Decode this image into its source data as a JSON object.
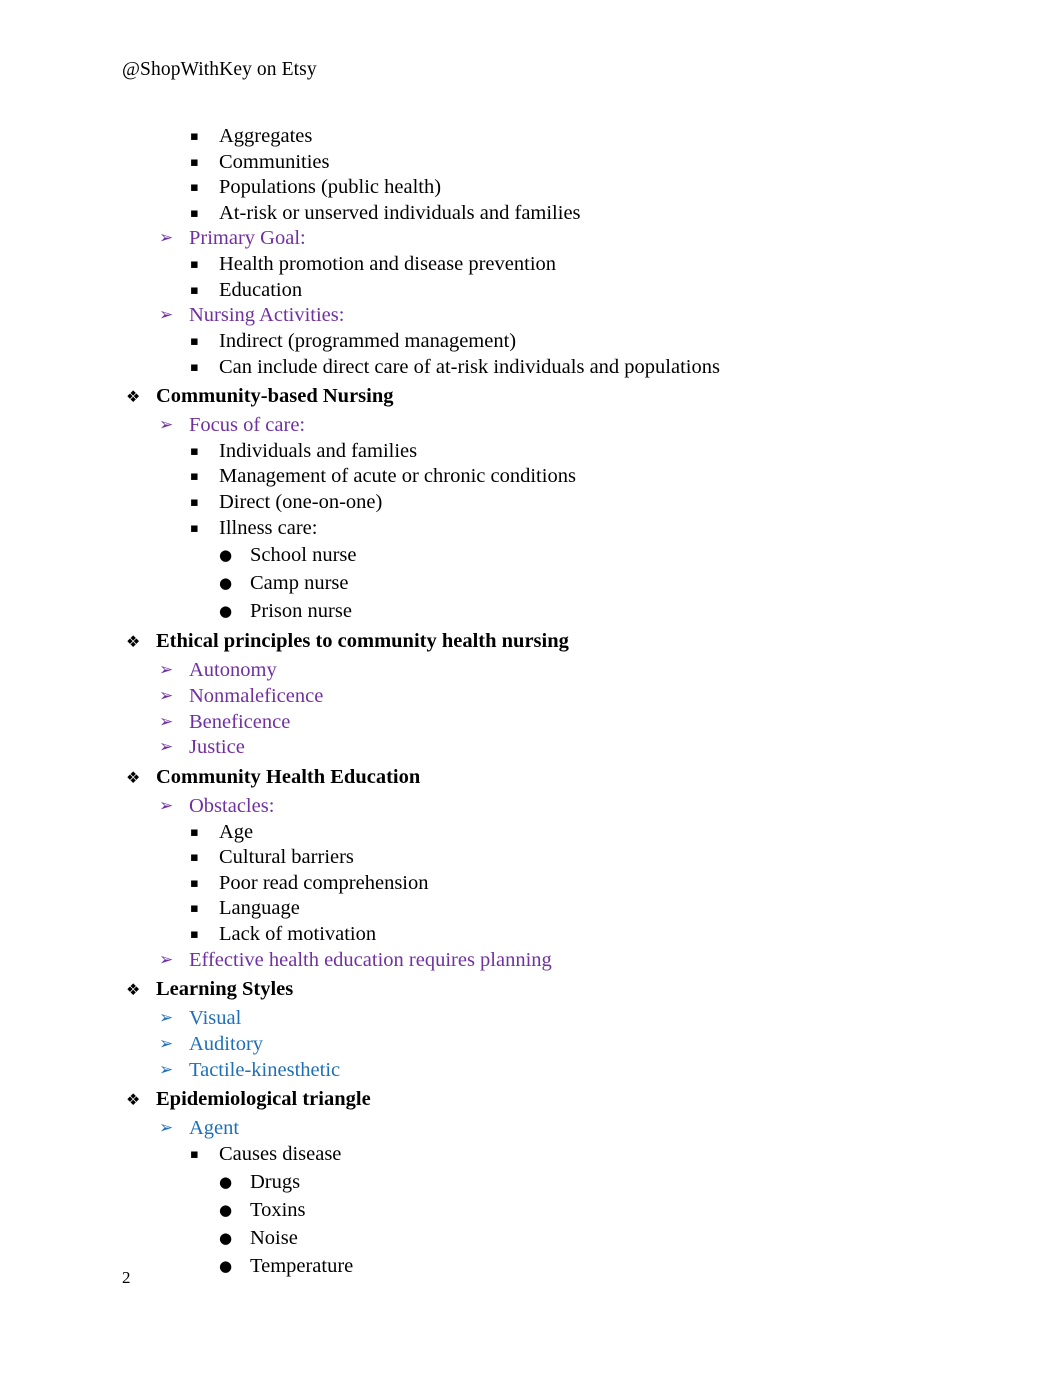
{
  "header": {
    "shop_handle": "@ShopWithKey on Etsy"
  },
  "footer": {
    "page_number": "2"
  },
  "colors": {
    "purple": "#7030A0",
    "blue": "#1F6FB8",
    "black": "#000000"
  },
  "bullets": {
    "level1": "❖",
    "level2": "➢",
    "level3": "▪",
    "level4": "●"
  },
  "outline": [
    {
      "level": 3,
      "color": "black",
      "text": "Aggregates"
    },
    {
      "level": 3,
      "color": "black",
      "text": "Communities"
    },
    {
      "level": 3,
      "color": "black",
      "text": "Populations (public health)"
    },
    {
      "level": 3,
      "color": "black",
      "text": "At-risk or unserved individuals and families"
    },
    {
      "level": 2,
      "color": "purple",
      "text": "Primary Goal:"
    },
    {
      "level": 3,
      "color": "black",
      "text": "Health promotion and disease prevention"
    },
    {
      "level": 3,
      "color": "black",
      "text": "Education"
    },
    {
      "level": 2,
      "color": "purple",
      "text": "Nursing Activities:"
    },
    {
      "level": 3,
      "color": "black",
      "text": "Indirect (programmed management)"
    },
    {
      "level": 3,
      "color": "black",
      "text": "Can include direct care of at-risk individuals and populations"
    },
    {
      "level": 1,
      "color": "black",
      "text": "Community-based Nursing"
    },
    {
      "level": 2,
      "color": "purple",
      "text": "Focus of care:"
    },
    {
      "level": 3,
      "color": "black",
      "text": "Individuals and families"
    },
    {
      "level": 3,
      "color": "black",
      "text": "Management of acute or chronic conditions"
    },
    {
      "level": 3,
      "color": "black",
      "text": "Direct (one-on-one)"
    },
    {
      "level": 3,
      "color": "black",
      "text": "Illness care:"
    },
    {
      "level": 4,
      "color": "black",
      "text": "School nurse"
    },
    {
      "level": 4,
      "color": "black",
      "text": "Camp nurse"
    },
    {
      "level": 4,
      "color": "black",
      "text": "Prison nurse"
    },
    {
      "level": 1,
      "color": "black",
      "text": "Ethical principles to community health nursing"
    },
    {
      "level": 2,
      "color": "purple",
      "text": "Autonomy"
    },
    {
      "level": 2,
      "color": "purple",
      "text": "Nonmaleficence"
    },
    {
      "level": 2,
      "color": "purple",
      "text": "Beneficence"
    },
    {
      "level": 2,
      "color": "purple",
      "text": "Justice"
    },
    {
      "level": 1,
      "color": "black",
      "text": "Community Health Education"
    },
    {
      "level": 2,
      "color": "purple",
      "text": "Obstacles:"
    },
    {
      "level": 3,
      "color": "black",
      "text": "Age"
    },
    {
      "level": 3,
      "color": "black",
      "text": "Cultural barriers"
    },
    {
      "level": 3,
      "color": "black",
      "text": "Poor read comprehension"
    },
    {
      "level": 3,
      "color": "black",
      "text": "Language"
    },
    {
      "level": 3,
      "color": "black",
      "text": "Lack of motivation"
    },
    {
      "level": 2,
      "color": "purple",
      "text": "Effective health education requires planning"
    },
    {
      "level": 1,
      "color": "black",
      "text": "Learning Styles"
    },
    {
      "level": 2,
      "color": "blue",
      "text": "Visual"
    },
    {
      "level": 2,
      "color": "blue",
      "text": "Auditory"
    },
    {
      "level": 2,
      "color": "blue",
      "text": "Tactile-kinesthetic"
    },
    {
      "level": 1,
      "color": "black",
      "text": "Epidemiological triangle"
    },
    {
      "level": 2,
      "color": "blue",
      "text": "Agent"
    },
    {
      "level": 3,
      "color": "black",
      "text": "Causes disease"
    },
    {
      "level": 4,
      "color": "black",
      "text": "Drugs"
    },
    {
      "level": 4,
      "color": "black",
      "text": "Toxins"
    },
    {
      "level": 4,
      "color": "black",
      "text": "Noise"
    },
    {
      "level": 4,
      "color": "black",
      "text": "Temperature"
    }
  ]
}
